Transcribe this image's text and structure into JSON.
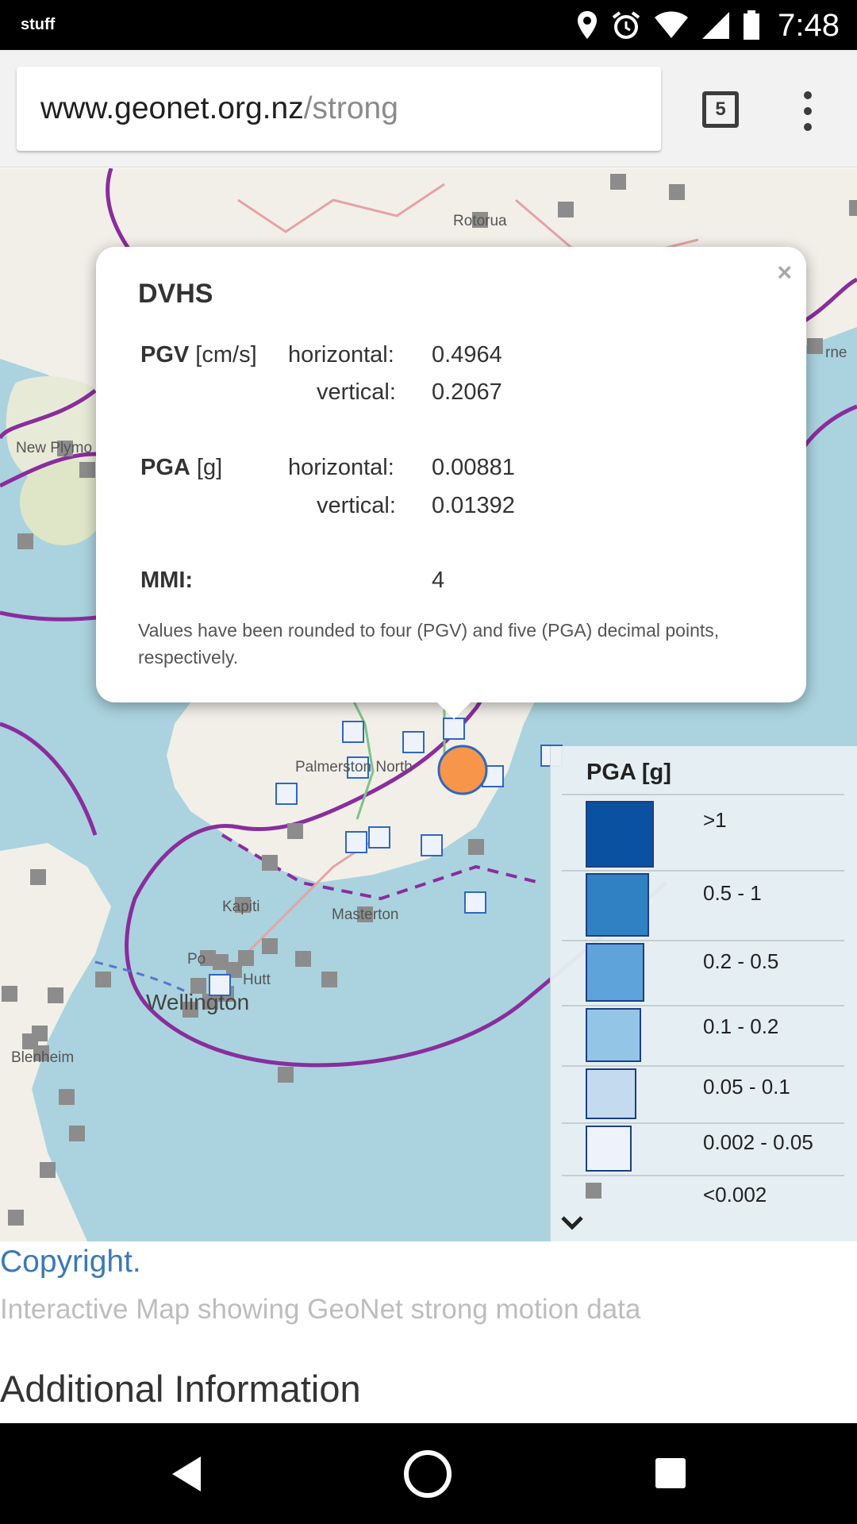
{
  "status_bar": {
    "carrier": "stuff",
    "time": "7:48",
    "icons": [
      "location-icon",
      "alarm-icon",
      "wifi-icon",
      "signal-icon",
      "battery-icon"
    ]
  },
  "browser": {
    "url_domain": "www.geonet.org.nz",
    "url_path": "/strong",
    "tab_count": "5"
  },
  "map": {
    "place_labels": {
      "rotorua": "Rotorua",
      "new_plymouth": "New Plymo",
      "napier": "rne",
      "palmerston_north": "Palmerston North",
      "kapiti": "Kapiti",
      "masterton": "Masterton",
      "porirua": "Po",
      "hutt": "Hutt",
      "wellington": "Wellington",
      "blenheim": "Blenheim"
    }
  },
  "popup": {
    "close": "×",
    "station": "DVHS",
    "pgv_label": "PGV",
    "pgv_unit": " [cm/s]",
    "pga_label": "PGA",
    "pga_unit": " [g]",
    "horizontal": "horizontal:",
    "vertical": "vertical:",
    "pgv_horizontal": "0.4964",
    "pgv_vertical": "0.2067",
    "pga_horizontal": "0.00881",
    "pga_vertical": "0.01392",
    "mmi_label": "MMI:",
    "mmi_value": "4",
    "note": "Values have been rounded to four (PGV) and five (PGA) decimal points, respectively."
  },
  "legend": {
    "title": "PGA [g]",
    "items": [
      {
        "label": ">1",
        "color": "#0a51a1"
      },
      {
        "label": "0.5 - 1",
        "color": "#3081c3"
      },
      {
        "label": "0.2 - 0.5",
        "color": "#5ea3d9"
      },
      {
        "label": "0.1 - 0.2",
        "color": "#93c6e6"
      },
      {
        "label": "0.05 - 0.1",
        "color": "#c4dbef"
      },
      {
        "label": "0.002 - 0.05",
        "color": "#eef3fb"
      },
      {
        "label": "<0.002",
        "color": "#8c8c8c"
      }
    ]
  },
  "page": {
    "copyright": "Copyright.",
    "caption": "Interactive Map showing GeoNet strong motion data",
    "heading": "Additional Information"
  },
  "colors": {
    "epicentre": "#f7954a",
    "boundary": "#8a2d9c",
    "sea": "#aad3df",
    "land": "#f2efe9"
  }
}
